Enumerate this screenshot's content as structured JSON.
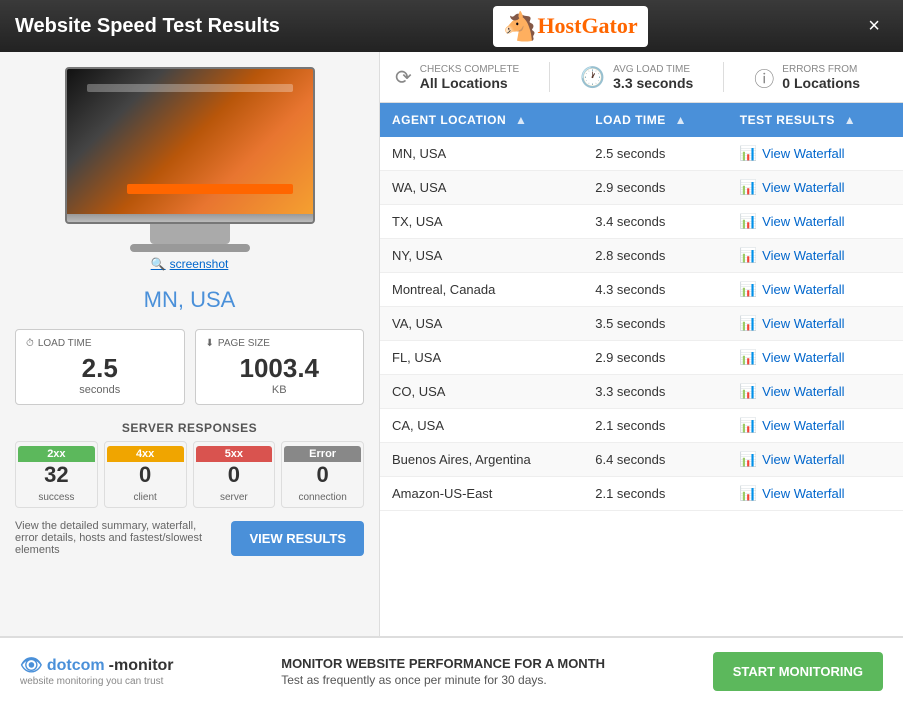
{
  "titleBar": {
    "title": "Website Speed Test Results",
    "closeLabel": "×"
  },
  "logo": {
    "text": "HostGator",
    "horse": "🐴"
  },
  "leftPanel": {
    "screenshotLabel": "screenshot",
    "locationTitle": "MN, USA",
    "metrics": {
      "loadTime": {
        "label": "LOAD TIME",
        "value": "2.5",
        "unit": "seconds"
      },
      "pageSize": {
        "label": "PAGE SIZE",
        "value": "1003.4",
        "unit": "KB"
      }
    },
    "serverResponsesTitle": "SERVER RESPONSES",
    "responses": [
      {
        "label": "2xx",
        "count": "32",
        "sub": "success",
        "class": "resp-2xx"
      },
      {
        "label": "4xx",
        "count": "0",
        "sub": "client",
        "class": "resp-4xx"
      },
      {
        "label": "5xx",
        "count": "0",
        "sub": "server",
        "class": "resp-5xx"
      },
      {
        "label": "Error",
        "count": "0",
        "sub": "connection",
        "class": "resp-error"
      }
    ],
    "viewResultsText": "View the detailed summary, waterfall, error details, hosts and fastest/slowest elements",
    "viewResultsBtn": "VIEW RESULTS"
  },
  "statsBar": {
    "checksComplete": {
      "label": "CHECKS COMPLETE",
      "value": "All Locations"
    },
    "avgLoadTime": {
      "label": "AVG LOAD TIME",
      "value": "3.3 seconds"
    },
    "errorsFrom": {
      "label": "ERRORS FROM",
      "value": "0 Locations"
    }
  },
  "tableHeaders": [
    {
      "label": "AGENT LOCATION",
      "sortable": true
    },
    {
      "label": "LOAD TIME",
      "sortable": true
    },
    {
      "label": "TEST RESULTS",
      "sortable": true
    }
  ],
  "tableRows": [
    {
      "location": "MN, USA",
      "loadTime": "2.5 seconds",
      "link": "View Waterfall"
    },
    {
      "location": "WA, USA",
      "loadTime": "2.9 seconds",
      "link": "View Waterfall"
    },
    {
      "location": "TX, USA",
      "loadTime": "3.4 seconds",
      "link": "View Waterfall"
    },
    {
      "location": "NY, USA",
      "loadTime": "2.8 seconds",
      "link": "View Waterfall"
    },
    {
      "location": "Montreal, Canada",
      "loadTime": "4.3 seconds",
      "link": "View Waterfall"
    },
    {
      "location": "VA, USA",
      "loadTime": "3.5 seconds",
      "link": "View Waterfall"
    },
    {
      "location": "FL, USA",
      "loadTime": "2.9 seconds",
      "link": "View Waterfall"
    },
    {
      "location": "CO, USA",
      "loadTime": "3.3 seconds",
      "link": "View Waterfall"
    },
    {
      "location": "CA, USA",
      "loadTime": "2.1 seconds",
      "link": "View Waterfall"
    },
    {
      "location": "Buenos Aires, Argentina",
      "loadTime": "6.4 seconds",
      "link": "View Waterfall"
    },
    {
      "location": "Amazon-US-East",
      "loadTime": "2.1 seconds",
      "link": "View Waterfall"
    }
  ],
  "footer": {
    "brandName": "dotcom-monitor",
    "brandTagline": "website monitoring you can trust",
    "promoTitle": "MONITOR WEBSITE PERFORMANCE FOR A MONTH",
    "promoText": "Test as frequently as once per minute for 30 days.",
    "startBtn": "START MONITORING"
  }
}
